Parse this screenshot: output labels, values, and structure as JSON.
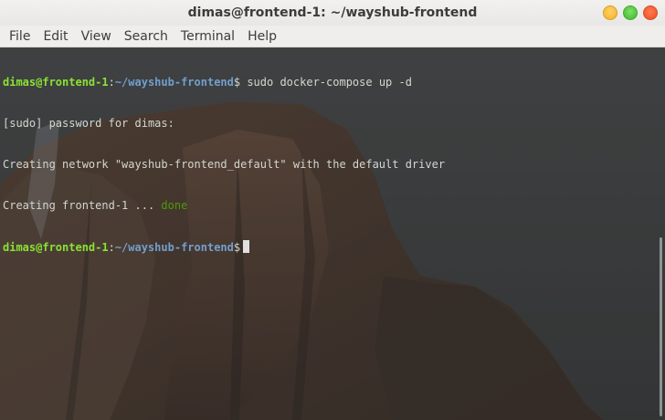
{
  "window": {
    "title": "dimas@frontend-1: ~/wayshub-frontend",
    "controls": {
      "minimize_icon": "minimize-icon",
      "maximize_icon": "maximize-icon",
      "close_icon": "close-icon"
    }
  },
  "menubar": {
    "items": [
      {
        "label": "File"
      },
      {
        "label": "Edit"
      },
      {
        "label": "View"
      },
      {
        "label": "Search"
      },
      {
        "label": "Terminal"
      },
      {
        "label": "Help"
      }
    ]
  },
  "terminal": {
    "prompt_user": "dimas@frontend-1",
    "prompt_path": "~/wayshub-frontend",
    "lines": [
      {
        "type": "prompt",
        "command": " sudo docker-compose up -d"
      },
      {
        "type": "output",
        "text": "[sudo] password for dimas:"
      },
      {
        "type": "output",
        "text": "Creating network \"wayshub-frontend_default\" with the default driver"
      },
      {
        "type": "status",
        "text": "Creating frontend-1 ... ",
        "status": "done"
      },
      {
        "type": "prompt",
        "command": ""
      }
    ]
  },
  "colors": {
    "prompt_user": "#8ae234",
    "prompt_path": "#729fcf",
    "status_done": "#4e9a06",
    "terminal_text": "#d3d7cf"
  }
}
